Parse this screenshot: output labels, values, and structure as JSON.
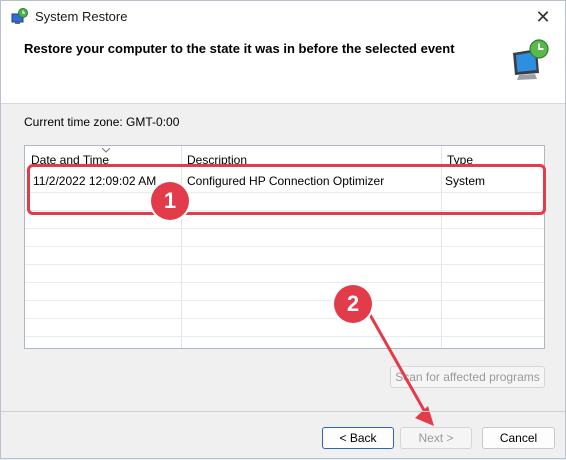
{
  "window": {
    "title": "System Restore",
    "close_glyph": "✕"
  },
  "header": {
    "title": "Restore your computer to the state it was in before the selected event"
  },
  "timezone": {
    "label": "Current time zone: GMT-0:00"
  },
  "list": {
    "columns": [
      "Date and Time",
      "Description",
      "Type"
    ],
    "rows": [
      {
        "date": "11/2/2022 12:09:02 AM",
        "description": "Configured HP Connection Optimizer",
        "type": "System"
      }
    ]
  },
  "buttons": {
    "scan": "Scan for affected programs",
    "back": "< Back",
    "next": "Next >",
    "cancel": "Cancel"
  },
  "annotations": {
    "badge1": "1",
    "badge2": "2",
    "accent_color": "#e23b4a"
  },
  "icons": {
    "title": "system-restore-icon",
    "header": "monitor-restore-icon"
  }
}
